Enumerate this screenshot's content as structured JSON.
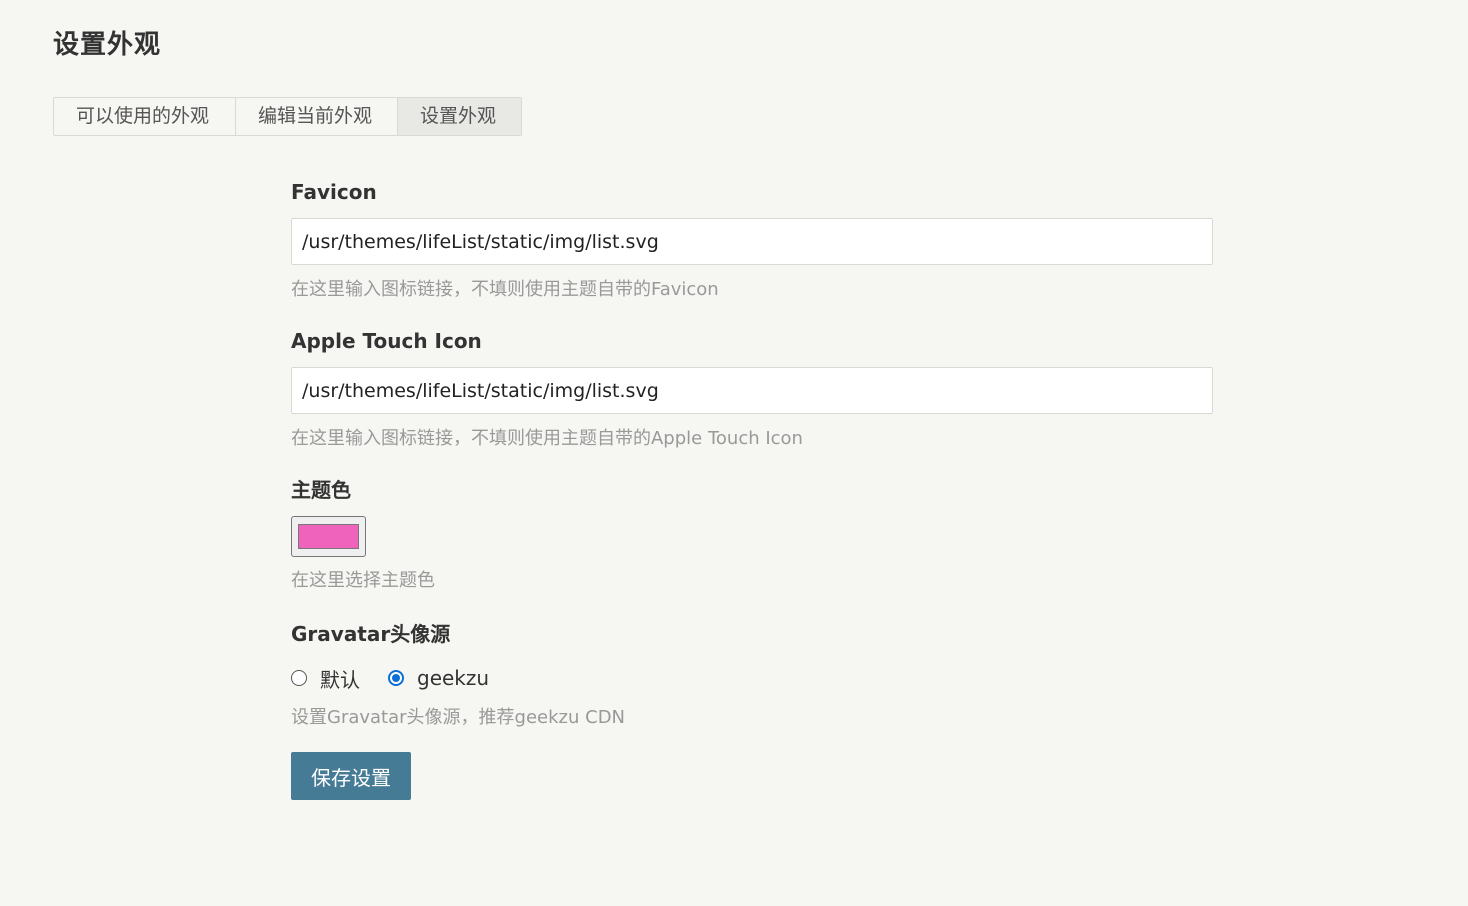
{
  "page": {
    "title": "设置外观"
  },
  "tabs": [
    {
      "label": "可以使用的外观",
      "active": false
    },
    {
      "label": "编辑当前外观",
      "active": false
    },
    {
      "label": "设置外观",
      "active": true
    }
  ],
  "form": {
    "favicon": {
      "label": "Favicon",
      "value": "/usr/themes/lifeList/static/img/list.svg",
      "hint": "在这里输入图标链接，不填则使用主题自带的Favicon"
    },
    "apple_touch_icon": {
      "label": "Apple Touch Icon",
      "value": "/usr/themes/lifeList/static/img/list.svg",
      "hint": "在这里输入图标链接，不填则使用主题自带的Apple Touch Icon"
    },
    "theme_color": {
      "label": "主题色",
      "value": "#f063bd",
      "hint": "在这里选择主题色"
    },
    "gravatar": {
      "label": "Gravatar头像源",
      "options": [
        {
          "label": "默认",
          "checked": false
        },
        {
          "label": "geekzu",
          "checked": true
        }
      ],
      "hint": "设置Gravatar头像源，推荐geekzu CDN"
    },
    "save_label": "保存设置"
  },
  "colors": {
    "primary_button": "#467b96",
    "radio_accent": "#0b6fd8",
    "background": "#f6f6f3"
  }
}
